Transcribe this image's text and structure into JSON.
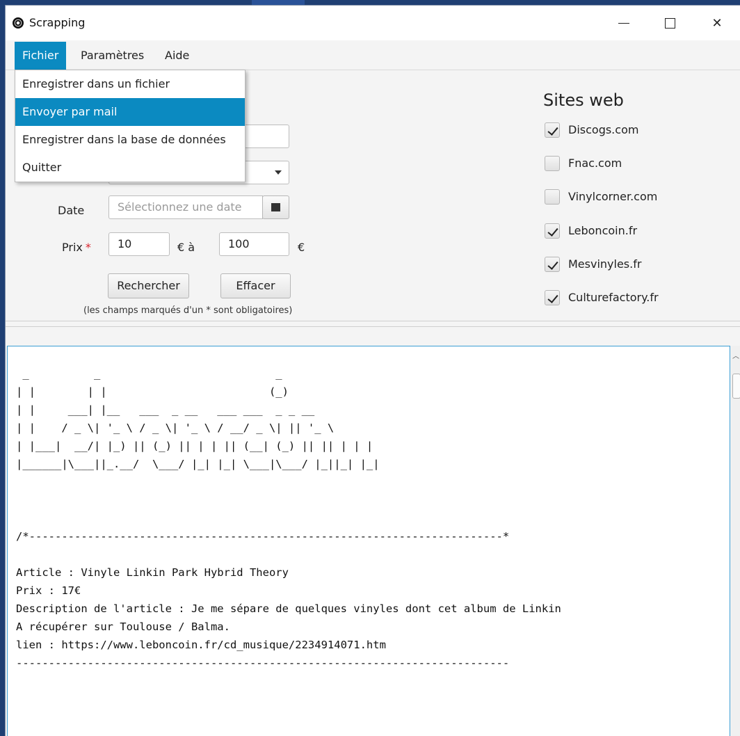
{
  "window": {
    "title": "Scrapping"
  },
  "menubar": {
    "items": [
      "Fichier",
      "Paramètres",
      "Aide"
    ]
  },
  "file_menu": {
    "items": [
      "Enregistrer dans un fichier",
      "Envoyer par mail",
      "Enregistrer dans la base de données",
      "Quitter"
    ],
    "highlighted": "Envoyer par mail"
  },
  "form": {
    "date_label": "Date",
    "date_placeholder": "Sélectionnez une date",
    "price_label": "Prix",
    "required_mark": "*",
    "price_min": "10",
    "price_sep": "€ à",
    "price_max": "100",
    "currency": "€",
    "search_button": "Rechercher",
    "clear_button": "Effacer",
    "required_hint": "(les champs marqués d'un * sont obligatoires)"
  },
  "sites": {
    "title": "Sites web",
    "items": [
      {
        "label": "Discogs.com",
        "checked": true
      },
      {
        "label": "Fnac.com",
        "checked": false
      },
      {
        "label": "Vinylcorner.com",
        "checked": false
      },
      {
        "label": "Leboncoin.fr",
        "checked": true
      },
      {
        "label": "Mesvinyles.fr",
        "checked": true
      },
      {
        "label": "Culturefactory.fr",
        "checked": true
      }
    ]
  },
  "output": {
    "text": " _          _                           _\n| |        | |                         (_)\n| |     ___| |__   ___  _ __   ___ ___  _ _ __\n| |    / _ \\| '_ \\ / _ \\| '_ \\ / __/ _ \\| || '_ \\\n| |___|  __/| |_) || (_) || | | || (__| (_) || || | | |\n|______|\\___||_.__/  \\___/ |_| |_| \\___|\\___/ |_||_| |_|\n\n\n\n/*-------------------------------------------------------------------------*\n\nArticle : Vinyle Linkin Park Hybrid Theory\nPrix : 17€\nDescription de l'article : Je me sépare de quelques vinyles dont cet album de Linkin\nA récupérer sur Toulouse / Balma.\nlien : https://www.leboncoin.fr/cd_musique/2234914071.htm\n----------------------------------------------------------------------------"
  }
}
